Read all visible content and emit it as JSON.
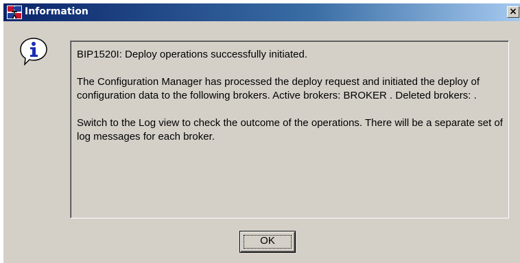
{
  "window": {
    "title": "Information",
    "close_label": "×"
  },
  "message": {
    "line1": "BIP1520I: Deploy operations successfully initiated.",
    "line2": "The Configuration Manager has processed the deploy request and initiated the deploy of configuration data to the following brokers. Active brokers: BROKER . Deleted brokers:  .",
    "line3": "Switch to the Log view to check the outcome of the operations.  There will be a separate set of log messages for each broker."
  },
  "buttons": {
    "ok_label": "OK"
  },
  "icons": {
    "title": "app-logo-icon",
    "info": "information-icon"
  },
  "colors": {
    "titlebar_start": "#0a246a",
    "titlebar_end": "#a6caf0",
    "dialog_bg": "#d4d0c8",
    "info_blue": "#1c2fb4"
  }
}
